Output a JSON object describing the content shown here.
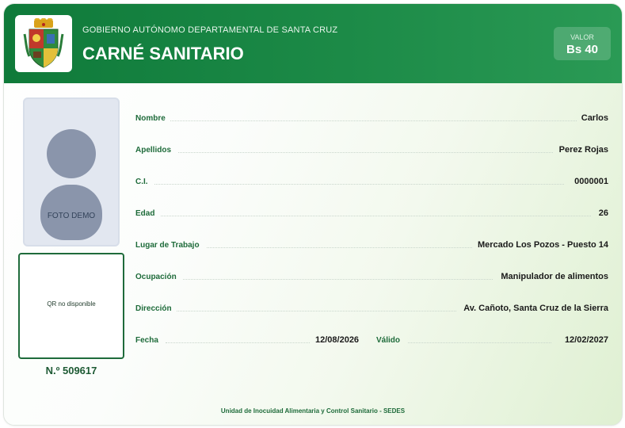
{
  "header": {
    "gov_name": "GOBIERNO AUTÓNOMO DEPARTAMENTAL DE SANTA CRUZ",
    "title": "CARNÉ SANITARIO",
    "value_label": "VALOR",
    "value_amount": "Bs 40",
    "logo_icon": "coat-of-arms-icon"
  },
  "photo": {
    "label": "FOTO DEMO"
  },
  "qr": {
    "label": "QR no disponible"
  },
  "serial": "N.º 509617",
  "fields": {
    "nombre": {
      "label": "Nombre",
      "value": "Carlos"
    },
    "apellidos": {
      "label": "Apellidos",
      "value": "Perez Rojas"
    },
    "ci": {
      "label": "C.I.",
      "value": "0000001"
    },
    "edad": {
      "label": "Edad",
      "value": "26"
    },
    "lugar": {
      "label": "Lugar de Trabajo",
      "value": "Mercado Los Pozos - Puesto 14"
    },
    "ocupacion": {
      "label": "Ocupación",
      "value": "Manipulador de alimentos"
    },
    "direccion": {
      "label": "Dirección",
      "value": "Av. Cañoto, Santa Cruz de la Sierra"
    },
    "fecha": {
      "label": "Fecha",
      "value": "12/08/2026"
    },
    "valido": {
      "label": "Válido",
      "value": "12/02/2027"
    }
  },
  "footer": "Unidad de Inocuidad Alimentaria y Control Sanitario - SEDES",
  "colors": {
    "header_green": "#0f7a3a",
    "label_green": "#1e6b3a",
    "photo_placeholder": "#8a95ab"
  }
}
